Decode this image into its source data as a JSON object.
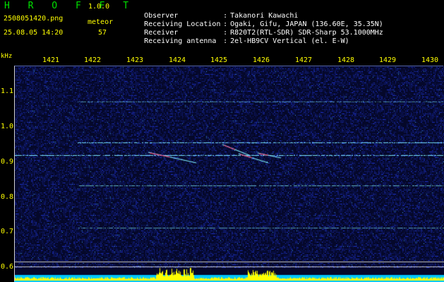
{
  "header": {
    "app_title": "H R O F F T",
    "app_version": "1.0.0",
    "filename": "2508051420.png",
    "mode": "meteor",
    "datetime": "25.08.05 14:20",
    "count": "57"
  },
  "info": [
    {
      "label": "Observer",
      "value": "Takanori Kawachi"
    },
    {
      "label": "Receiving Location",
      "value": "Ogaki, Gifu, JAPAN (136.60E, 35.35N)"
    },
    {
      "label": "Receiver",
      "value": "R820T2(RTL-SDR) SDR-Sharp 53.1000MHz"
    },
    {
      "label": "Receiving antenna",
      "value": "2el-HB9CV Vertical (el. E-W)"
    }
  ],
  "axes": {
    "y_unit": "kHz",
    "x_ticks": [
      "1421",
      "1422",
      "1423",
      "1424",
      "1425",
      "1426",
      "1427",
      "1428",
      "1429",
      "1430"
    ],
    "y_ticks": [
      "1.1",
      "1.0",
      "0.9",
      "0.8",
      "0.7",
      "0.6"
    ]
  },
  "colors": {
    "accent": "#ffff00",
    "title": "#00e000",
    "text": "#ffffff",
    "background": "#000000",
    "noise": "#1a2a9a",
    "signal": "#80f0ff",
    "meteor": "#ff3060",
    "bottom_band": "#00c8ff",
    "bottom_peaks": "#ffff00"
  }
}
